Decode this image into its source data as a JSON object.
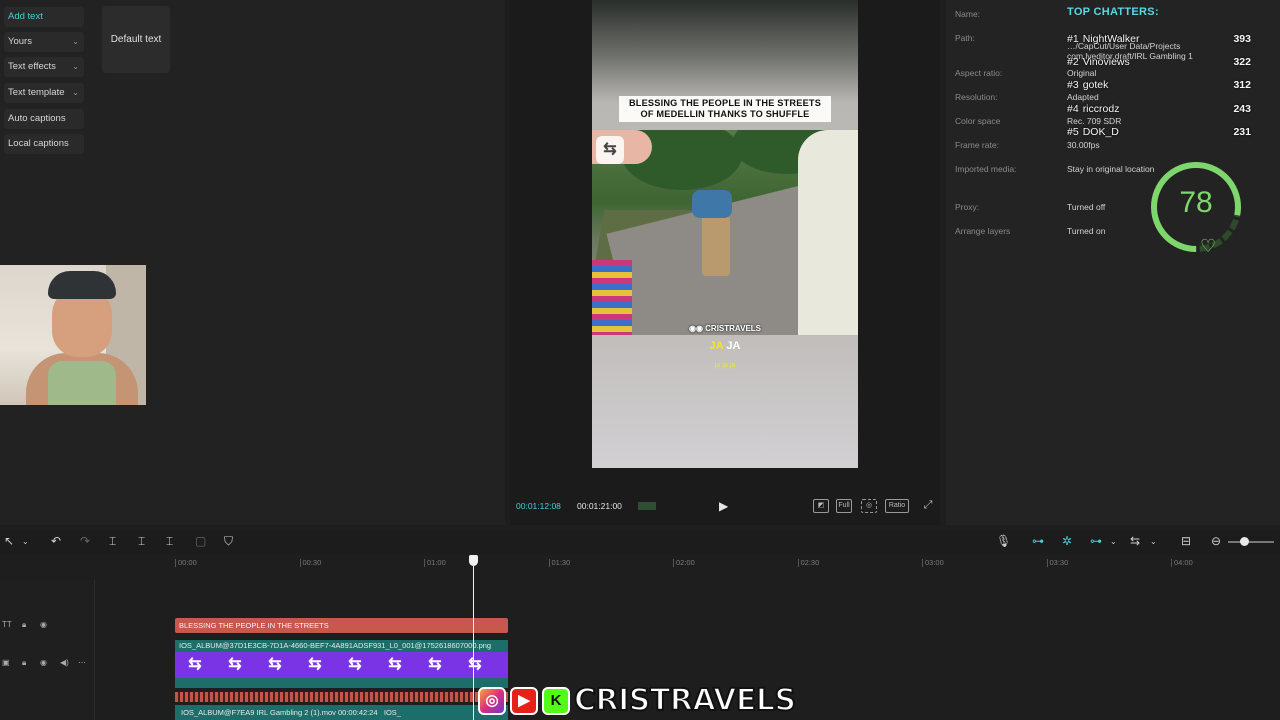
{
  "text_panel": {
    "categories": [
      {
        "label": "Add text",
        "active": true,
        "chevron": false
      },
      {
        "label": "Yours",
        "active": false,
        "chevron": true
      },
      {
        "label": "Text effects",
        "active": false,
        "chevron": true
      },
      {
        "label": "Text template",
        "active": false,
        "chevron": true
      },
      {
        "label": "Auto captions",
        "active": false,
        "chevron": false
      },
      {
        "label": "Local captions",
        "active": false,
        "chevron": false
      }
    ],
    "default_text_card": "Default text"
  },
  "player": {
    "caption_line1": "BLESSING THE PEOPLE IN THE STREETS",
    "caption_line2": "OF MEDELLIN THANKS TO SHUFFLE",
    "watermark": "CRISTRAVELS",
    "subtitle_highlight": "JA",
    "subtitle_rest": "JA",
    "subtitle_small": "ja ja ja",
    "timecode_current": "00:01:12:08",
    "timecode_total": "00:01:21:00",
    "controls": [
      "Full",
      "Ratio"
    ]
  },
  "details": {
    "rows": [
      {
        "label": "Name:",
        "value": ""
      },
      {
        "label": "Path:",
        "value": "…/CapCut/User Data/Projects com.lveditor.draft/IRL Gambling 1"
      },
      {
        "label": "Aspect ratio:",
        "value": "Original"
      },
      {
        "label": "Resolution:",
        "value": "Adapted"
      },
      {
        "label": "Color space",
        "value": "Rec. 709 SDR"
      },
      {
        "label": "Frame rate:",
        "value": "30.00fps"
      },
      {
        "label": "Imported media:",
        "value": "Stay in original location"
      },
      {
        "label": "Proxy:",
        "value": "Turned off"
      },
      {
        "label": "Arrange layers",
        "value": "Turned on"
      }
    ]
  },
  "chatters": {
    "title": "TOP CHATTERS:",
    "entries": [
      {
        "rank": "#1",
        "name": "NightWalker",
        "points": "393"
      },
      {
        "rank": "#2",
        "name": "Vinoviews",
        "points": "322"
      },
      {
        "rank": "#3",
        "name": "gotek",
        "points": "312"
      },
      {
        "rank": "#4",
        "name": "riccrodz",
        "points": "243"
      },
      {
        "rank": "#5",
        "name": "DOK_D",
        "points": "231"
      }
    ]
  },
  "score": {
    "value": "78",
    "fraction": 0.78,
    "color": "#7fd66d"
  },
  "timeline": {
    "ruler_ticks": [
      "00:00",
      "00:30",
      "01:00",
      "01:30",
      "02:00",
      "02:30",
      "03:00",
      "03:30",
      "04:00"
    ],
    "text_clip": "BLESSING THE PEOPLE IN THE STREETS",
    "video_clip_label": "IOS_ALBUM@37D1E3CB-7D1A-4660-BEF7-4A891ADSF931_L0_001@1752618607000.png",
    "bottom_clip_label": "IOS_ALBUM@F7EA9   IRL Gambling 2 (1).mov   00:00:42:24",
    "bottom_clip_suffix": "IOS_"
  },
  "brand": {
    "name": "CRISTRAVELS",
    "icons": [
      "instagram-icon",
      "youtube-icon",
      "kick-icon"
    ]
  }
}
